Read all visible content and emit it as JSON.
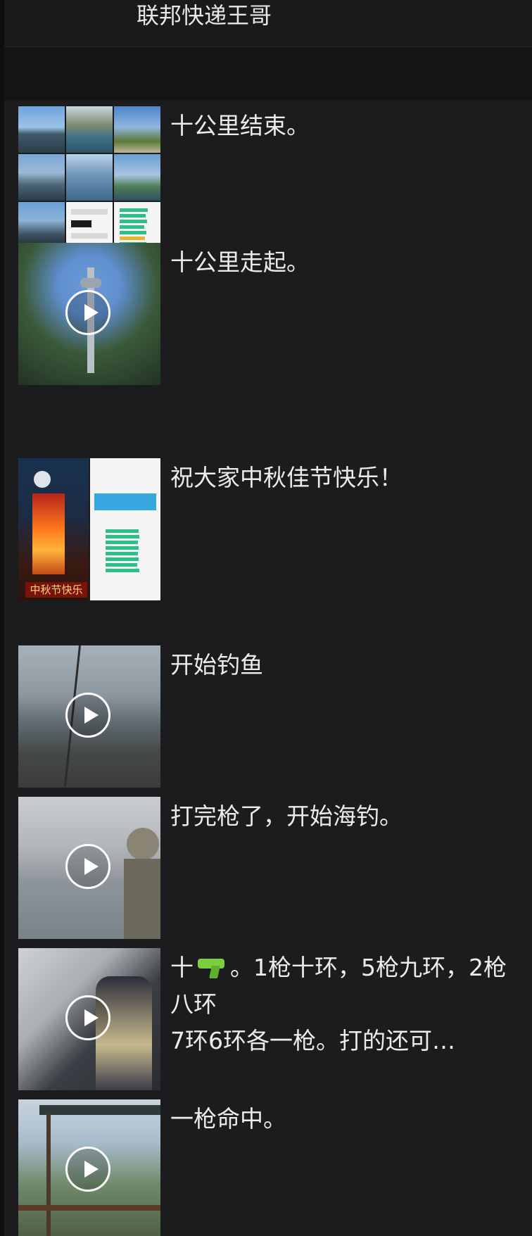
{
  "header": {
    "title": "联邦快递王哥"
  },
  "posts": [
    {
      "caption": "十公里结束。",
      "media": "photo-grid"
    },
    {
      "caption": "十公里走起。",
      "media": "video"
    },
    {
      "caption": "祝大家中秋佳节快乐！",
      "media": "photo-pair",
      "overlay_text": "中秋节快乐"
    },
    {
      "caption": "开始钓鱼",
      "media": "video"
    },
    {
      "caption": "打完枪了，开始海钓。",
      "media": "video"
    },
    {
      "caption_prefix": "十",
      "caption_emoji": "water-pistol-icon",
      "caption": "。1枪十环，5枪九环，2枪八环\n7环6环各一枪。打的还可…",
      "media": "video"
    },
    {
      "caption": "一枪命中。",
      "media": "video"
    }
  ],
  "colors": {
    "background": "#1c1c1e",
    "text": "#ececec",
    "accent": "#2fbf86"
  }
}
